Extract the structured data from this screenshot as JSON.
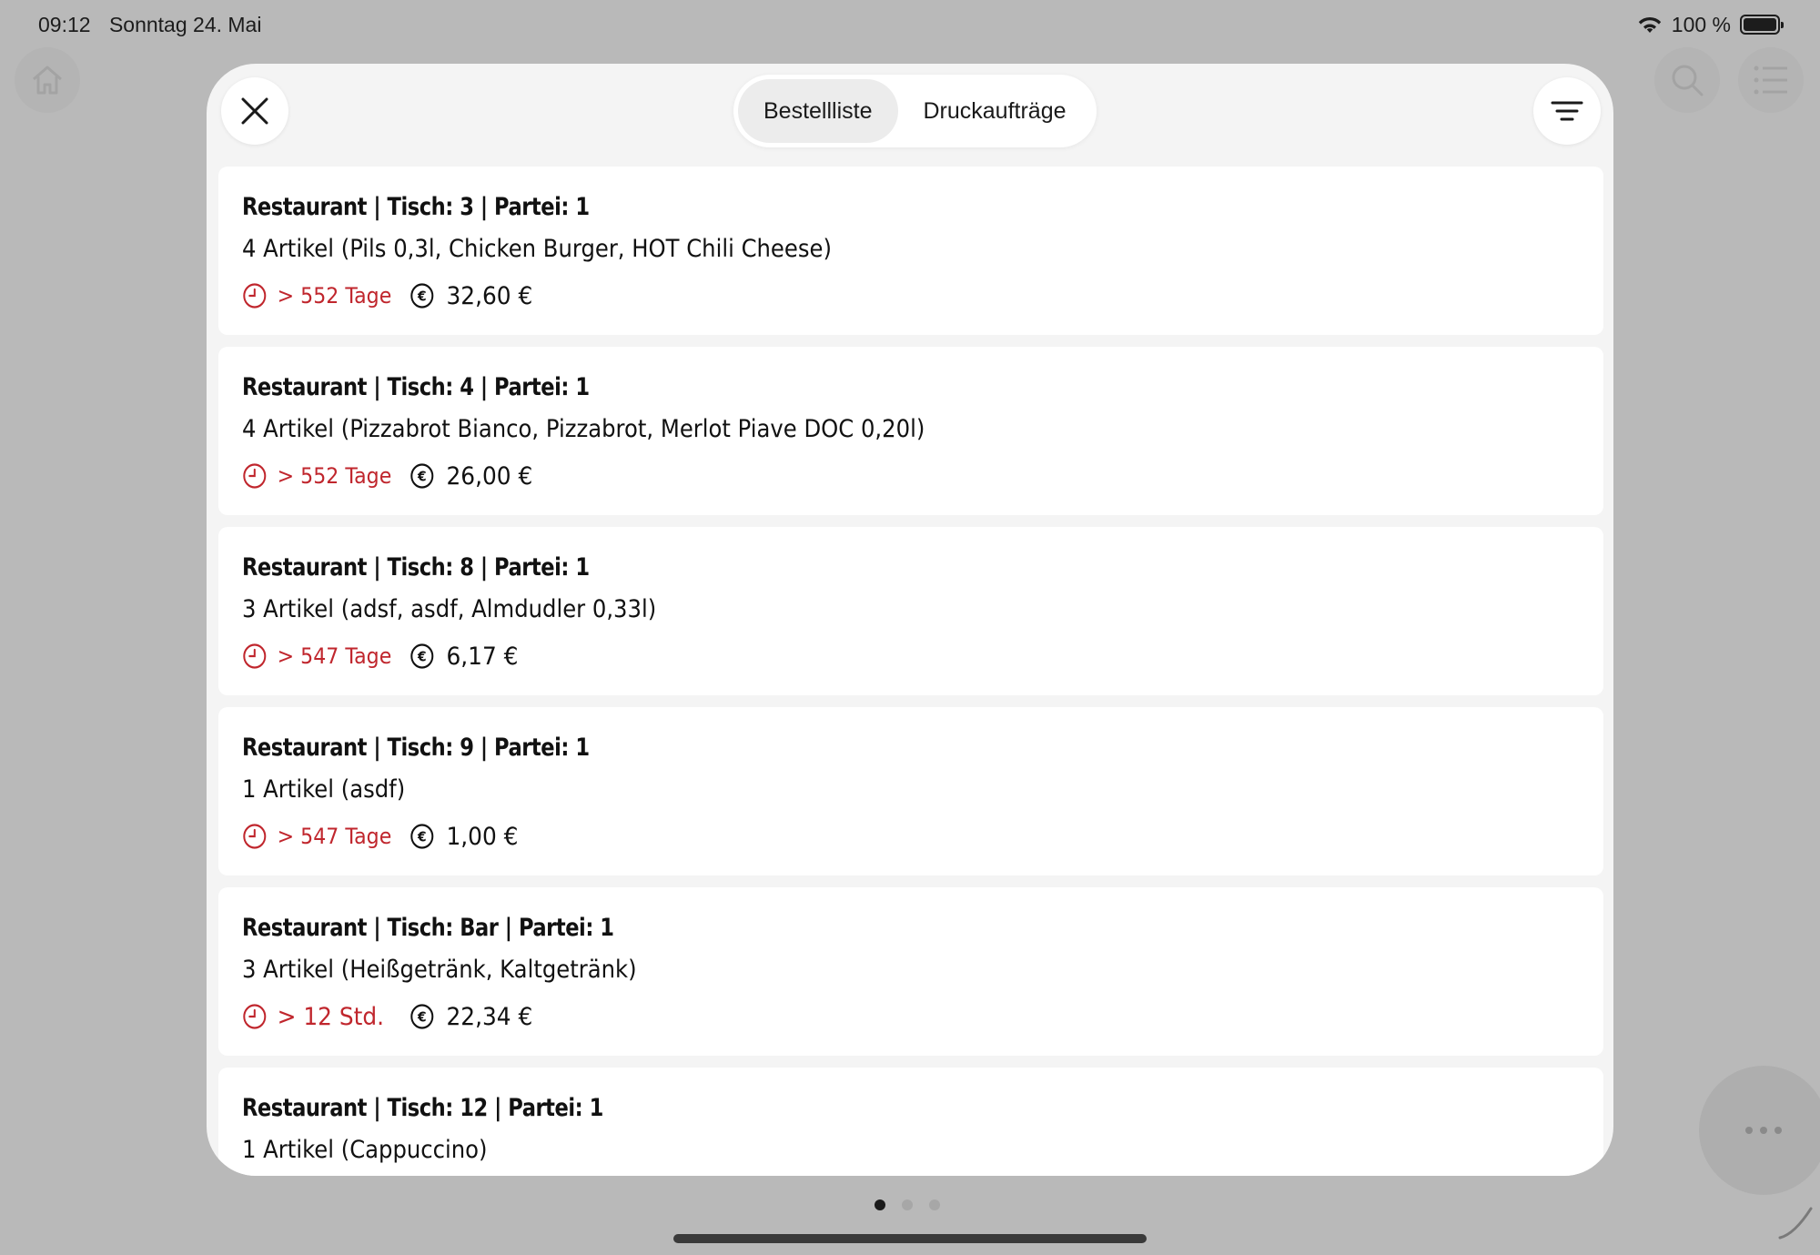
{
  "status_bar": {
    "time": "09:12",
    "date": "Sonntag 24. Mai",
    "battery": "100 %"
  },
  "header": {
    "tabs": [
      {
        "label": "Bestellliste",
        "active": true
      },
      {
        "label": "Druckaufträge",
        "active": false
      }
    ]
  },
  "orders": [
    {
      "title": "Restaurant | Tisch: 3 | Partei: 1",
      "items": "4 Artikel (Pils 0,3l, Chicken Burger, HOT Chili Cheese)",
      "age": "> 552 Tage",
      "price": "32,60 €"
    },
    {
      "title": "Restaurant | Tisch: 4 | Partei: 1",
      "items": "4 Artikel (Pizzabrot Bianco, Pizzabrot, Merlot Piave DOC 0,20l)",
      "age": "> 552 Tage",
      "price": "26,00 €"
    },
    {
      "title": "Restaurant | Tisch: 8 | Partei: 1",
      "items": "3 Artikel (adsf, asdf, Almdudler 0,33l)",
      "age": "> 547 Tage",
      "price": "6,17 €"
    },
    {
      "title": "Restaurant | Tisch: 9 | Partei: 1",
      "items": "1 Artikel (asdf)",
      "age": "> 547 Tage",
      "price": "1,00 €"
    },
    {
      "title": "Restaurant | Tisch: Bar | Partei: 1",
      "items": "3 Artikel (Heißgetränk, Kaltgetränk)",
      "age": "> 12 Std.",
      "price": "22,34 €"
    },
    {
      "title": "Restaurant | Tisch: 12 | Partei: 1",
      "items": "1 Artikel (Cappuccino)",
      "age": "",
      "price": ""
    }
  ],
  "icons": {
    "close": "close-icon",
    "filter": "filter-icon",
    "time": "clock-icon",
    "price": "euro-icon",
    "home": "home-icon",
    "search": "search-icon",
    "list": "list-icon",
    "more": "more-icon"
  },
  "colors": {
    "accent_red": "#c0262d",
    "modal_bg": "#f4f4f4",
    "card_bg": "#ffffff",
    "backdrop": "#b9b9b9"
  },
  "pagination": {
    "pages": 3,
    "current": 1
  }
}
